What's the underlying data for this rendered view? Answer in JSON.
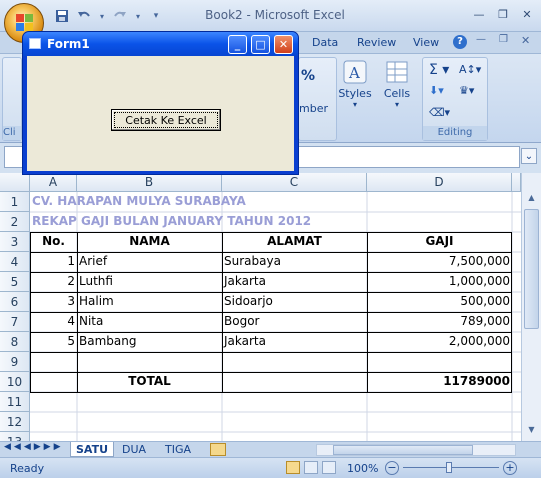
{
  "window": {
    "title": "Book2 - Microsoft Excel",
    "minimize_icon": "minimize-icon",
    "maximize_icon": "maximize-icon",
    "close_icon": "close-icon"
  },
  "ribbon": {
    "tabs": [
      "Data",
      "Review",
      "View"
    ],
    "groups": {
      "number_label": "mber",
      "styles_label": "Styles",
      "cells_label": "Cells",
      "editing_label": "Editing",
      "clip_label": "Cli",
      "percent": "%"
    }
  },
  "form1": {
    "title": "Form1",
    "button_label": "Cetak Ke Excel"
  },
  "grid": {
    "columns": [
      "A",
      "B",
      "C",
      "D"
    ],
    "rows": [
      "1",
      "2",
      "3",
      "4",
      "5",
      "6",
      "7",
      "8",
      "9",
      "10",
      "11",
      "12",
      "13"
    ],
    "title1": "CV. HARAPAN MULYA SURABAYA",
    "title2": "REKAP GAJI BULAN JANUARY TAHUN 2012",
    "headers": [
      "No.",
      "NAMA",
      "ALAMAT",
      "GAJI"
    ],
    "data": [
      [
        "1",
        "Arief",
        "Surabaya",
        "7,500,000"
      ],
      [
        "2",
        "Luthfi",
        "Jakarta",
        "1,000,000"
      ],
      [
        "3",
        "Halim",
        "Sidoarjo",
        "500,000"
      ],
      [
        "4",
        "Nita",
        "Bogor",
        "789,000"
      ],
      [
        "5",
        "Bambang",
        "Jakarta",
        "2,000,000"
      ]
    ],
    "total_label": "TOTAL",
    "total_value": "11789000"
  },
  "sheets": {
    "tabs": [
      "SATU",
      "DUA",
      "TIGA"
    ],
    "active": "SATU"
  },
  "status": {
    "ready": "Ready",
    "zoom": "100%"
  },
  "colors": {
    "title_text": "#9a9ed6",
    "xp_title": "#0a53e8"
  }
}
